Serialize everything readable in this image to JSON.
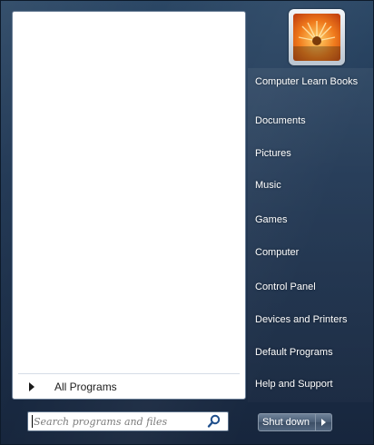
{
  "left_pane": {
    "all_programs_label": "All Programs"
  },
  "search": {
    "placeholder": "Search programs and files",
    "value": ""
  },
  "user": {
    "avatar_icon": "flower-picture-icon"
  },
  "right_pane": {
    "items": [
      {
        "label": "Computer Learn Books"
      },
      {
        "label": "Documents"
      },
      {
        "label": "Pictures"
      },
      {
        "label": "Music"
      },
      {
        "label": "Games"
      },
      {
        "label": "Computer"
      },
      {
        "label": "Control Panel"
      },
      {
        "label": "Devices and Printers"
      },
      {
        "label": "Default Programs"
      },
      {
        "label": "Help and Support"
      }
    ]
  },
  "shutdown": {
    "label": "Shut down"
  },
  "colors": {
    "menu_bg": "#1e3552",
    "left_pane_bg": "#ffffff",
    "text_light": "#ffffff",
    "avatar_orange": "#f07a1c"
  }
}
